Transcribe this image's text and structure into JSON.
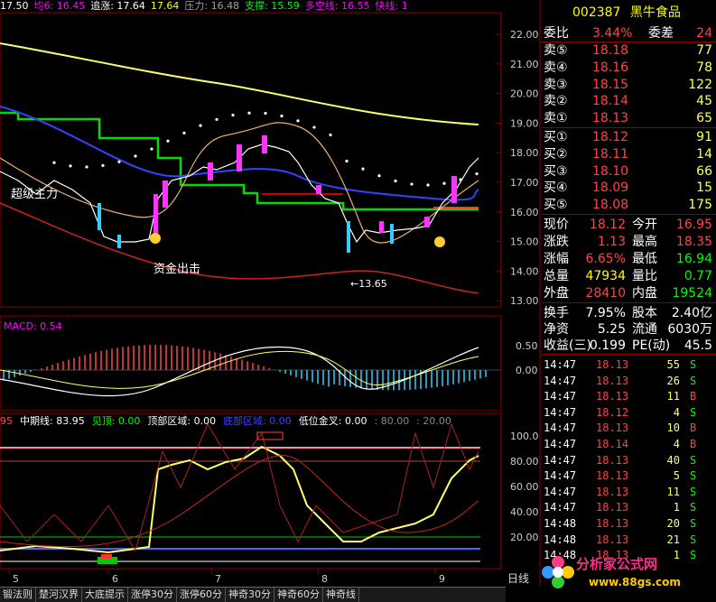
{
  "header": {
    "items": [
      {
        "label": "17.50",
        "color": "#ffffff"
      },
      {
        "label": "均6: 16.45",
        "color": "#ff00ff"
      },
      {
        "label": "追涨: 17.64",
        "color": "#ffffff"
      },
      {
        "label": "17.64",
        "color": "#ffff00"
      },
      {
        "label": "压力: 16.48",
        "color": "#a0a0a0"
      },
      {
        "label": "支撑: 15.59",
        "color": "#00ff00"
      },
      {
        "label": "多空线: 16.55",
        "color": "#ff00ff"
      },
      {
        "label": "快线: 1",
        "color": "#ff00ff"
      }
    ]
  },
  "main_chart": {
    "y_ticks": [
      "22.00",
      "21.00",
      "20.00",
      "19.00",
      "18.00",
      "17.00",
      "16.00",
      "15.00",
      "14.00",
      "13.00"
    ],
    "annotations": {
      "super_main": "超级主力",
      "fund_out": "资金出击",
      "low_label": "←13.65"
    }
  },
  "macd_chart": {
    "label": "MACD: 0.54",
    "y_ticks": [
      "0.50",
      "0.00"
    ]
  },
  "osc_chart": {
    "header_items": [
      {
        "label": "95",
        "color": "#ff4444"
      },
      {
        "label": "中期线: 83.95",
        "color": "#ffffff"
      },
      {
        "label": "见顶: 0.00",
        "color": "#00ff00"
      },
      {
        "label": "顶部区域: 0.00",
        "color": "#ffffff"
      },
      {
        "label": "底部区域: 0.00",
        "color": "#4040ff"
      },
      {
        "label": "低位金叉: 0.00",
        "color": "#ffffff"
      },
      {
        "label": ": 80.00",
        "color": "#888888"
      },
      {
        "label": ": 20.00",
        "color": "#888888"
      }
    ],
    "y_ticks": [
      "100.0",
      "80.00",
      "60.00",
      "40.00",
      "20.00"
    ]
  },
  "x_axis": {
    "labels": [
      "5",
      "6",
      "7",
      "8",
      "9"
    ],
    "period": "日线"
  },
  "tabs": [
    "锻法则",
    "楚河汉界",
    "大底提示",
    "涨停30分",
    "涨停60分",
    "神奇30分",
    "神奇60分",
    "神奇线"
  ],
  "quote": {
    "code": "002387",
    "name": "黑牛食品",
    "weibi": {
      "label": "委比",
      "value": "3.44%",
      "label2": "委差",
      "value2": "24"
    },
    "sell": [
      {
        "label": "卖⑤",
        "price": "18.18",
        "vol": "77"
      },
      {
        "label": "卖④",
        "price": "18.16",
        "vol": "78"
      },
      {
        "label": "卖③",
        "price": "18.15",
        "vol": "122"
      },
      {
        "label": "卖②",
        "price": "18.14",
        "vol": "45"
      },
      {
        "label": "卖①",
        "price": "18.13",
        "vol": "65"
      }
    ],
    "buy": [
      {
        "label": "买①",
        "price": "18.12",
        "vol": "91"
      },
      {
        "label": "买②",
        "price": "18.11",
        "vol": "14"
      },
      {
        "label": "买③",
        "price": "18.10",
        "vol": "66"
      },
      {
        "label": "买④",
        "price": "18.09",
        "vol": "15"
      },
      {
        "label": "买⑤",
        "price": "18.08",
        "vol": "175"
      }
    ],
    "stats": [
      {
        "l1": "现价",
        "v1": "18.12",
        "c1": "#ff4444",
        "l2": "今开",
        "v2": "16.95",
        "c2": "#ff4444"
      },
      {
        "l1": "涨跌",
        "v1": "1.13",
        "c1": "#ff4444",
        "l2": "最高",
        "v2": "18.35",
        "c2": "#ff4444"
      },
      {
        "l1": "涨幅",
        "v1": "6.65%",
        "c1": "#ff4444",
        "l2": "最低",
        "v2": "16.94",
        "c2": "#00ff00"
      },
      {
        "l1": "总量",
        "v1": "47934",
        "c1": "#ffff00",
        "l2": "量比",
        "v2": "0.77",
        "c2": "#00ff00"
      },
      {
        "l1": "外盘",
        "v1": "28410",
        "c1": "#ff4444",
        "l2": "内盘",
        "v2": "19524",
        "c2": "#00ff00"
      }
    ],
    "stats2": [
      {
        "l1": "换手",
        "v1": "7.95%",
        "l2": "股本",
        "v2": "2.40亿"
      },
      {
        "l1": "净资",
        "v1": "5.25",
        "l2": "流通",
        "v2": "6030万"
      },
      {
        "l1": "收益(三)",
        "v1": "0.199",
        "l2": "PE(动)",
        "v2": "45.5"
      }
    ],
    "ticks": [
      {
        "time": "14:47",
        "price": "18.13",
        "vol": "55",
        "side": "S"
      },
      {
        "time": "14:47",
        "price": "18.13",
        "vol": "26",
        "side": "S"
      },
      {
        "time": "14:47",
        "price": "18.13",
        "vol": "11",
        "side": "B"
      },
      {
        "time": "14:47",
        "price": "18.12",
        "vol": "4",
        "side": "S"
      },
      {
        "time": "14:47",
        "price": "18.13",
        "vol": "10",
        "side": "B"
      },
      {
        "time": "14:47",
        "price": "18.14",
        "vol": "4",
        "side": "B"
      },
      {
        "time": "14:47",
        "price": "18.13",
        "vol": "40",
        "side": "S"
      },
      {
        "time": "14:47",
        "price": "18.13",
        "vol": "5",
        "side": "S"
      },
      {
        "time": "14:47",
        "price": "18.13",
        "vol": "11",
        "side": "S"
      },
      {
        "time": "14:47",
        "price": "18.13",
        "vol": "1",
        "side": "S"
      },
      {
        "time": "14:48",
        "price": "18.13",
        "vol": "20",
        "side": "S"
      },
      {
        "time": "14:48",
        "price": "18.13",
        "vol": "21",
        "side": "S"
      },
      {
        "time": "14:48",
        "price": "18.13",
        "vol": "1",
        "side": "S"
      }
    ]
  },
  "watermark": {
    "text": "分析家公式网",
    "url": "www.88gs.com"
  }
}
